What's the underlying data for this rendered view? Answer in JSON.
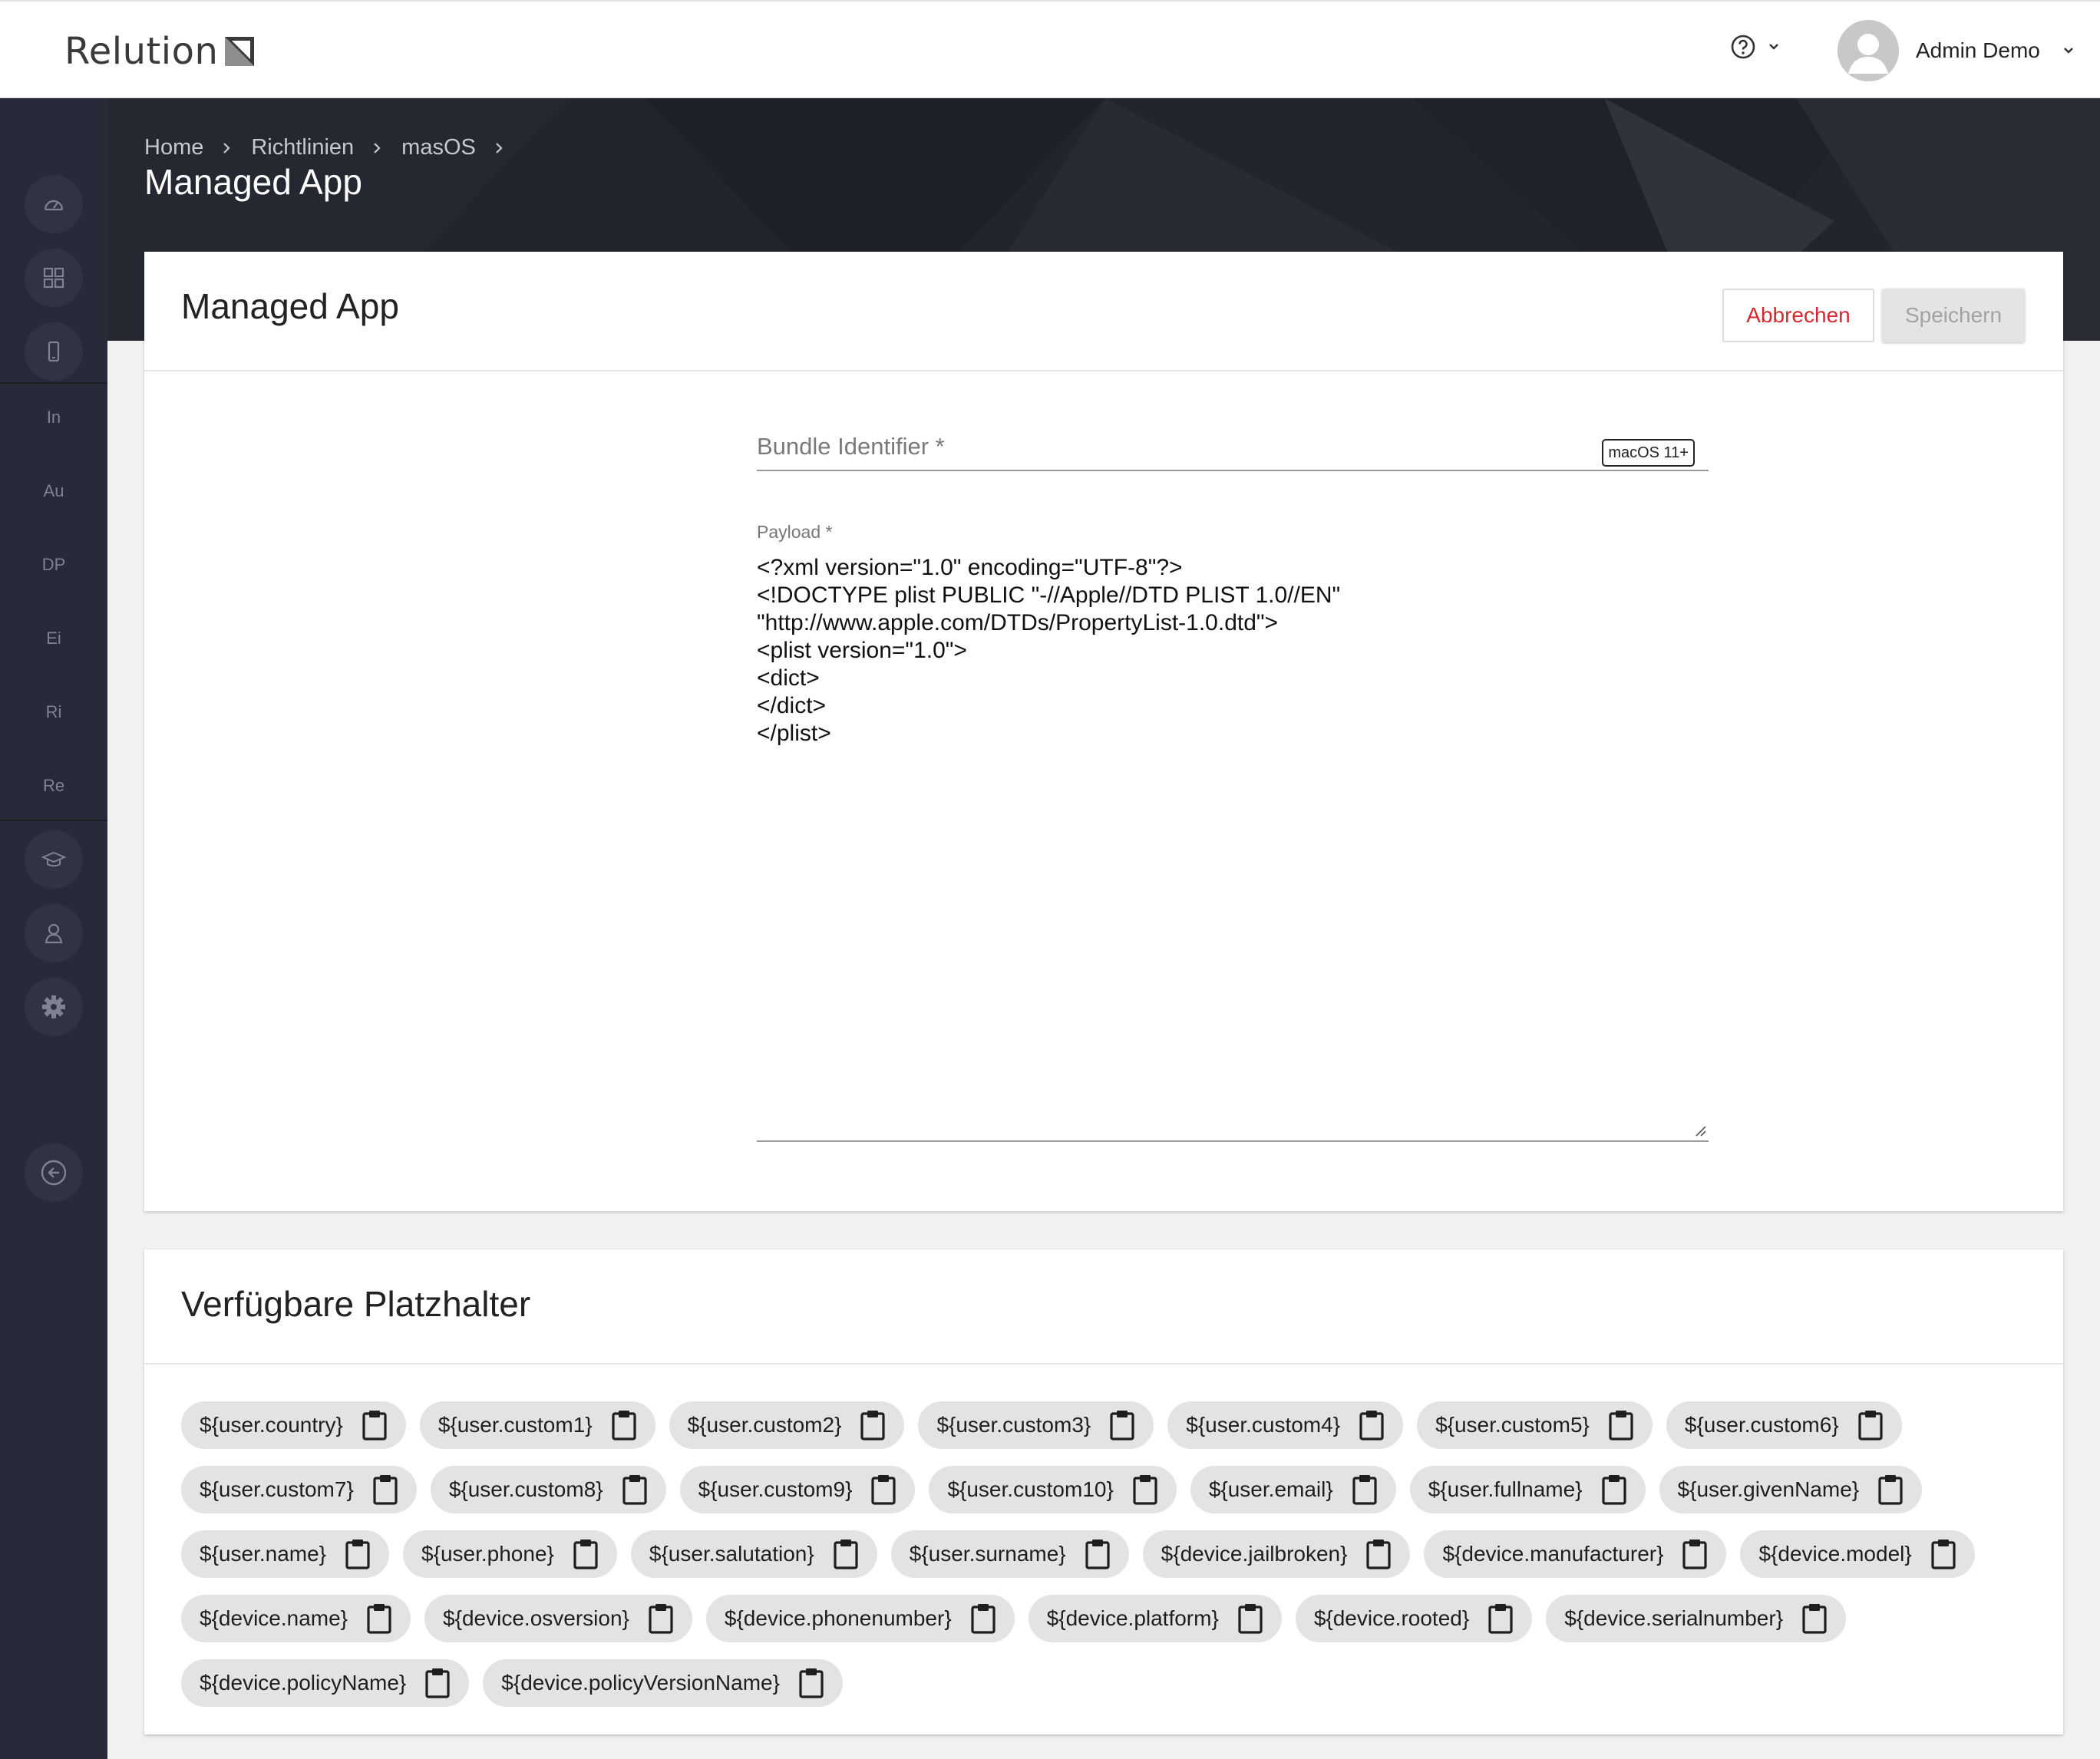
{
  "header": {
    "logo_text": "Relution",
    "user_name": "Admin Demo"
  },
  "sidebar": {
    "text_items": [
      "In",
      "Au",
      "DP",
      "Ei",
      "Ri",
      "Re"
    ]
  },
  "breadcrumb": [
    "Home",
    "Richtlinien",
    "masOS"
  ],
  "page_title": "Managed App",
  "form_card": {
    "title": "Managed App",
    "cancel_label": "Abbrechen",
    "save_label": "Speichern",
    "bundle_label": "Bundle Identifier *",
    "bundle_badge": "macOS 11+",
    "payload_label": "Payload *",
    "payload_lines": [
      "<?xml version=\"1.0\" encoding=\"UTF-8\"?>",
      "<!DOCTYPE plist PUBLIC \"-//Apple//DTD PLIST 1.0//EN\"",
      "\"http://www.apple.com/DTDs/PropertyList-1.0.dtd\">",
      "<plist version=\"1.0\">",
      "<dict>",
      "</dict>",
      "</plist>"
    ]
  },
  "placeholders_card": {
    "title": "Verfügbare Platzhalter",
    "items": [
      "${user.country}",
      "${user.custom1}",
      "${user.custom2}",
      "${user.custom3}",
      "${user.custom4}",
      "${user.custom5}",
      "${user.custom6}",
      "${user.custom7}",
      "${user.custom8}",
      "${user.custom9}",
      "${user.custom10}",
      "${user.email}",
      "${user.fullname}",
      "${user.givenName}",
      "${user.name}",
      "${user.phone}",
      "${user.salutation}",
      "${user.surname}",
      "${device.jailbroken}",
      "${device.manufacturer}",
      "${device.model}",
      "${device.name}",
      "${device.osversion}",
      "${device.phonenumber}",
      "${device.platform}",
      "${device.rooted}",
      "${device.serialnumber}",
      "${device.policyName}",
      "${device.policyVersionName}"
    ]
  },
  "colors": {
    "sidebar_bg": "#272a38",
    "cancel_text": "#d8262e",
    "chip_bg": "#e3e3e3"
  }
}
